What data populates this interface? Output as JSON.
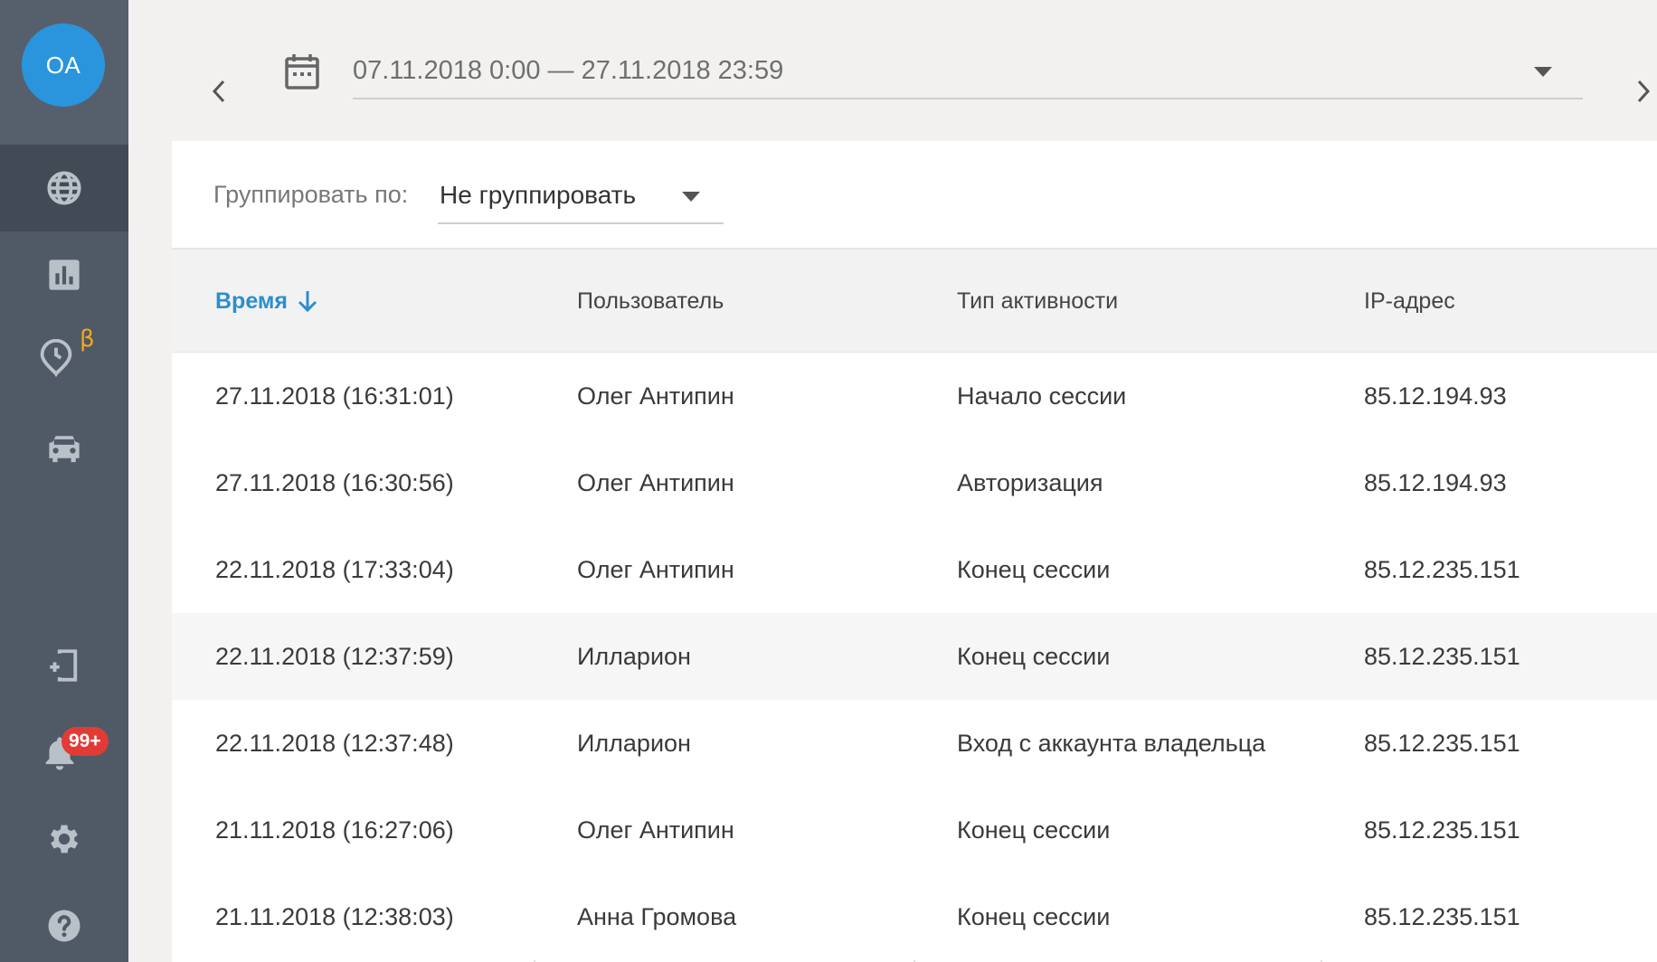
{
  "user": {
    "initials": "OA"
  },
  "sidebar": {
    "items": [
      {
        "name": "globe",
        "active": true
      },
      {
        "name": "chart"
      },
      {
        "name": "timeline",
        "badge": "β"
      },
      {
        "name": "car"
      },
      {
        "name": "device-add"
      },
      {
        "name": "notifications",
        "badge": "99+"
      },
      {
        "name": "settings"
      },
      {
        "name": "help"
      }
    ]
  },
  "date_range": {
    "value": "07.11.2018 0:00 — 27.11.2018 23:59"
  },
  "grouping": {
    "label": "Группировать по:",
    "value": "Не группировать"
  },
  "table": {
    "columns": [
      "Время",
      "Пользователь",
      "Тип активности",
      "IP-адрес"
    ],
    "sorted_column": "Время",
    "rows": [
      [
        "27.11.2018 (16:31:01)",
        "Олег Антипин",
        "Начало сессии",
        "85.12.194.93"
      ],
      [
        "27.11.2018 (16:30:56)",
        "Олег Антипин",
        "Авторизация",
        "85.12.194.93"
      ],
      [
        "22.11.2018 (17:33:04)",
        "Олег Антипин",
        "Конец сессии",
        "85.12.235.151"
      ],
      [
        "22.11.2018 (12:37:59)",
        "Илларион",
        "Конец сессии",
        "85.12.235.151"
      ],
      [
        "22.11.2018 (12:37:48)",
        "Илларион",
        "Вход с аккаунта владельца",
        "85.12.235.151"
      ],
      [
        "21.11.2018 (16:27:06)",
        "Олег Антипин",
        "Конец сессии",
        "85.12.235.151"
      ],
      [
        "21.11.2018 (12:38:03)",
        "Анна Громова",
        "Конец сессии",
        "85.12.235.151"
      ]
    ]
  },
  "colors": {
    "accent": "#2a95dc",
    "sidebar": "#4f5a66",
    "badge": "#e23b36",
    "beta": "#f4a51c"
  }
}
